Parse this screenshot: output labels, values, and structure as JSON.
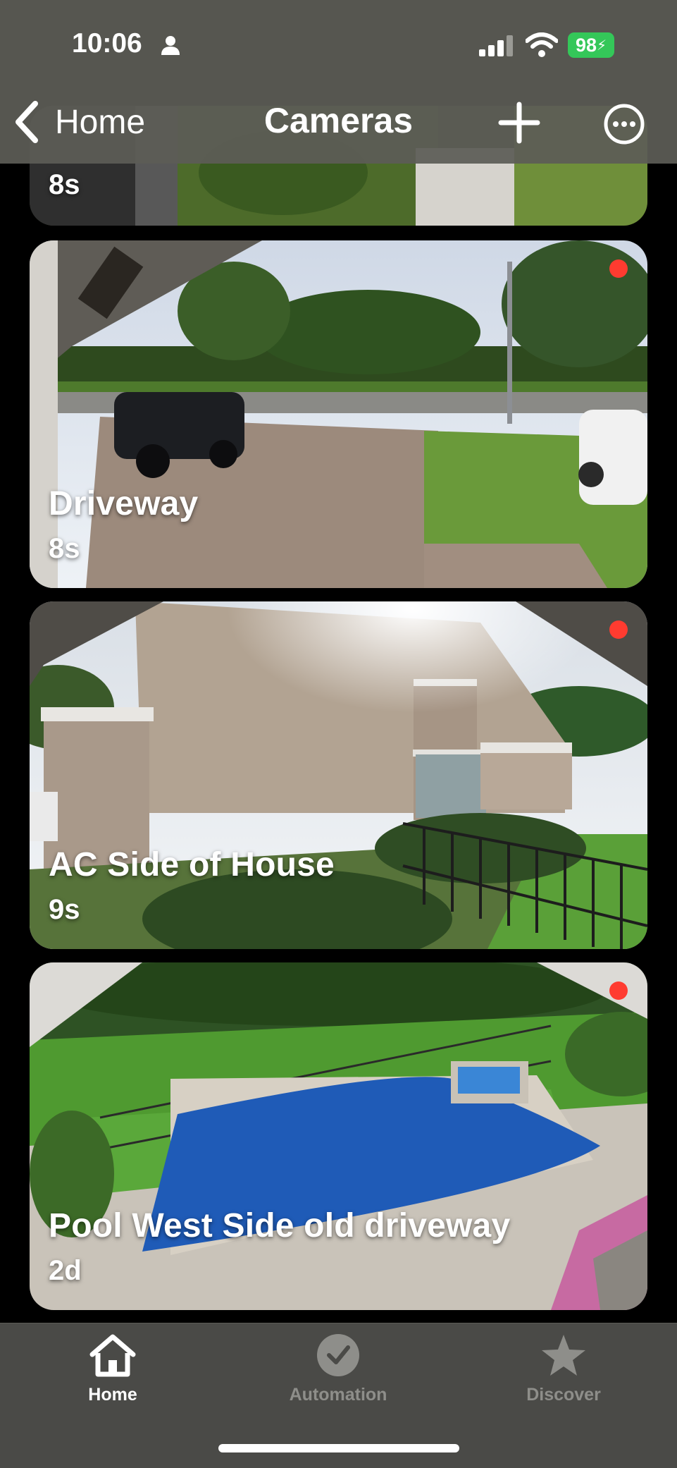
{
  "status_bar": {
    "time": "10:06",
    "battery": "98"
  },
  "nav": {
    "back_label": "Home",
    "title": "Cameras"
  },
  "cameras": [
    {
      "name": "",
      "time_ago": "8s"
    },
    {
      "name": "Driveway",
      "time_ago": "8s"
    },
    {
      "name": "AC Side of House",
      "time_ago": "9s"
    },
    {
      "name": "Pool West Side old driveway",
      "time_ago": "2d"
    }
  ],
  "tabs": [
    {
      "label": "Home",
      "icon": "house-icon",
      "selected": true
    },
    {
      "label": "Automation",
      "icon": "clock-check-icon",
      "selected": false
    },
    {
      "label": "Discover",
      "icon": "star-icon",
      "selected": false
    }
  ],
  "colors": {
    "accent_live": "#ff3b30",
    "battery": "#34c759",
    "tab_selected": "#ffffff",
    "tab_unselected": "#8e8e8a"
  }
}
